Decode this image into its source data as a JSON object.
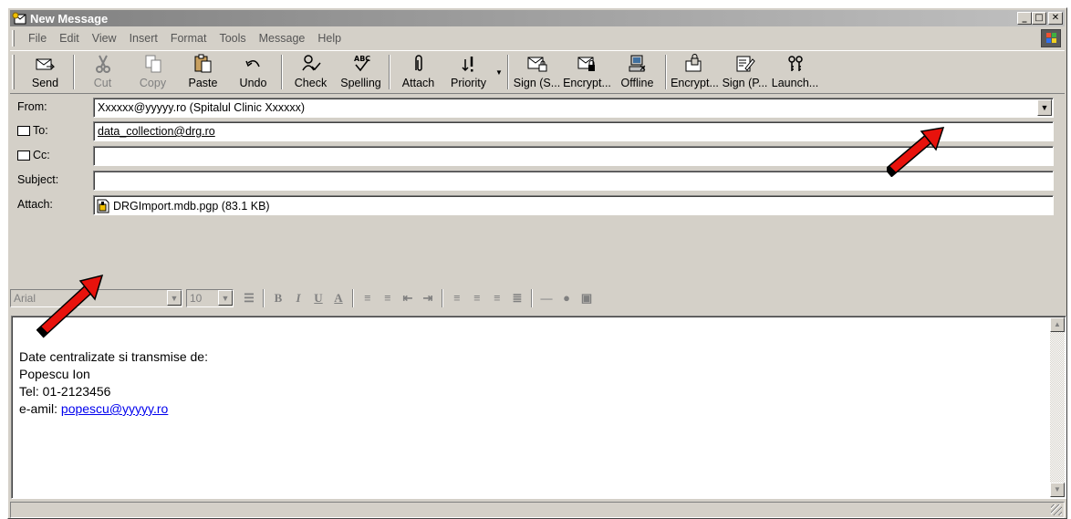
{
  "window": {
    "title": "New Message"
  },
  "menu": [
    "File",
    "Edit",
    "View",
    "Insert",
    "Format",
    "Tools",
    "Message",
    "Help"
  ],
  "toolbar": {
    "send": "Send",
    "cut": "Cut",
    "copy": "Copy",
    "paste": "Paste",
    "undo": "Undo",
    "check": "Check",
    "spelling": "Spelling",
    "attach": "Attach",
    "priority": "Priority",
    "sign_s": "Sign (S...",
    "encrypt1": "Encrypt...",
    "offline": "Offline",
    "encrypt2": "Encrypt...",
    "sign_p": "Sign (P...",
    "launch": "Launch..."
  },
  "fields": {
    "from_label": "From:",
    "from_value": "Xxxxxx@yyyyy.ro    (Spitalul Clinic Xxxxxx)",
    "to_label": "To:",
    "to_value": "data_collection@drg.ro",
    "cc_label": "Cc:",
    "cc_value": "",
    "subject_label": "Subject:",
    "subject_value": "",
    "attach_label": "Attach:",
    "attach_value": "DRGImport.mdb.pgp (83.1 KB)"
  },
  "format": {
    "font": "Arial",
    "size": "10"
  },
  "body": {
    "line1": "Date centralizate si transmise de:",
    "line2": "Popescu Ion",
    "line3": "Tel: 01-2123456",
    "line4_prefix": "e-amil: ",
    "line4_link": "popescu@yyyyy.ro"
  },
  "colors": {
    "annotation_arrow": "#e8120c",
    "titlebar": "#808080",
    "link": "#0000ee"
  }
}
